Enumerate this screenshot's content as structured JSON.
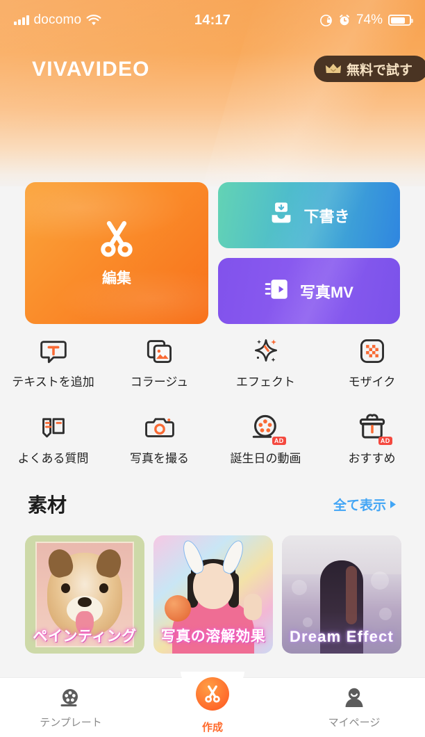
{
  "status_bar": {
    "carrier": "docomo",
    "wifi_icon": "wifi-icon",
    "signal_icon": "signal-bars-icon",
    "time": "14:17",
    "rotation_lock_icon": "rotation-lock-icon",
    "alarm_icon": "alarm-clock-icon",
    "battery_percent": "74%",
    "battery_level": 74
  },
  "header": {
    "logo": "VIVAVIDEO",
    "premium_button": {
      "label": "無料で試す",
      "icon": "crown-icon"
    },
    "gradient_from": "#f8a14e",
    "gradient_to": "#f3f1ef"
  },
  "main_cards": {
    "edit": {
      "label": "編集",
      "icon": "scissors-icon",
      "color": "#f8701a"
    },
    "draft": {
      "label": "下書き",
      "icon": "inbox-tray-icon",
      "color": "#2f86e0"
    },
    "photo_mv": {
      "label": "写真MV",
      "icon": "3d-play-card-icon",
      "color": "#8152ec"
    }
  },
  "features": {
    "row1": [
      {
        "label": "テキストを追加",
        "icon": "text-bubble-icon",
        "ad": false
      },
      {
        "label": "コラージュ",
        "icon": "collage-photos-icon",
        "ad": false
      },
      {
        "label": "エフェクト",
        "icon": "sparkle-effect-icon",
        "ad": false
      },
      {
        "label": "モザイク",
        "icon": "mosaic-grid-icon",
        "ad": false
      }
    ],
    "row2": [
      {
        "label": "よくある質問",
        "icon": "faq-book-icon",
        "ad": false
      },
      {
        "label": "写真を撮る",
        "icon": "camera-icon",
        "ad": false
      },
      {
        "label": "誕生日の動画",
        "icon": "film-reel-icon",
        "ad": true,
        "ad_label": "AD"
      },
      {
        "label": "おすすめ",
        "icon": "gift-box-icon",
        "ad": true,
        "ad_label": "AD"
      }
    ]
  },
  "materials": {
    "title": "素材",
    "see_all": "全て表示",
    "see_all_icon": "chevron-right-icon",
    "see_all_color": "#42a5f5",
    "thumbnails": [
      {
        "caption": "ペインティング",
        "subject": "shiba-dog-painting-thumbnail"
      },
      {
        "caption": "写真の溶解効果",
        "subject": "girl-bunny-ears-thumbnail"
      },
      {
        "caption": "Dream Effect",
        "subject": "silhouette-dream-thumbnail"
      }
    ]
  },
  "bottom_nav": {
    "items": [
      {
        "label": "テンプレート",
        "icon": "film-reel-icon",
        "active": false
      },
      {
        "label": "作成",
        "icon": "scissors-icon",
        "active": true
      },
      {
        "label": "マイページ",
        "icon": "person-icon",
        "active": false
      }
    ],
    "active_color": "#ff6a2b",
    "inactive_color": "#8a8a8a"
  }
}
